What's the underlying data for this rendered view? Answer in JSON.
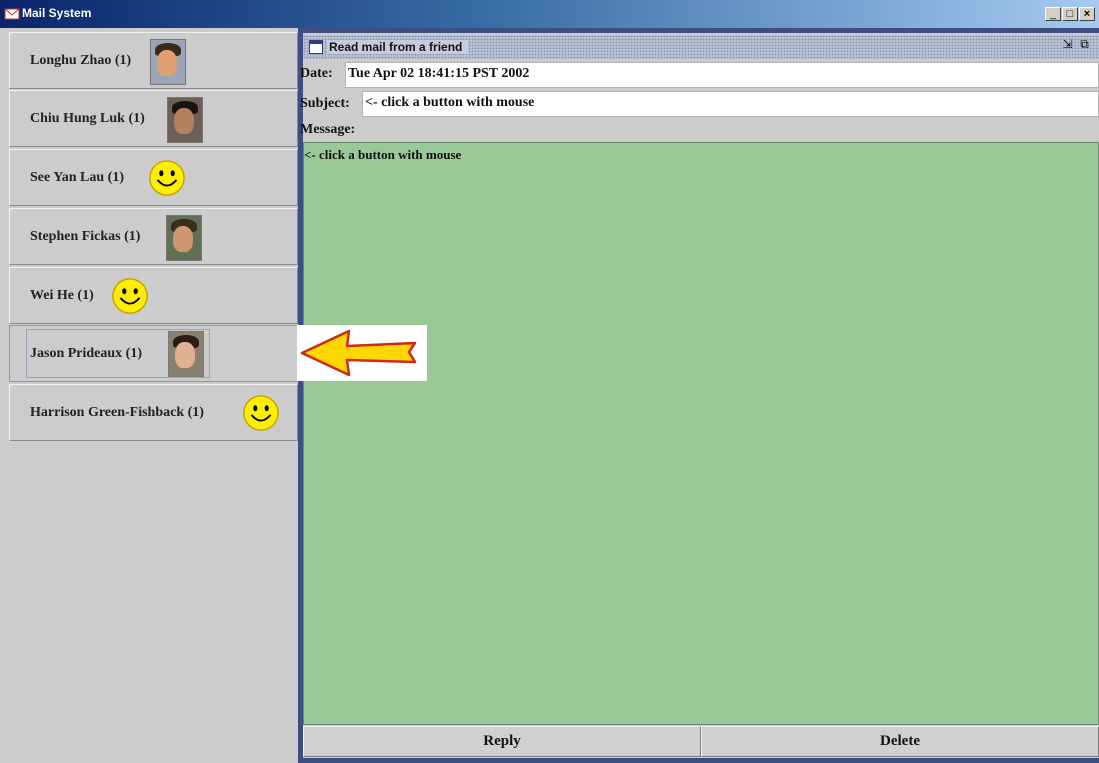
{
  "window": {
    "title": "Mail System",
    "controls": {
      "minimize": "_",
      "maximize": "□",
      "close": "×"
    }
  },
  "friends": [
    {
      "label": "Longhu Zhao (1)",
      "icon": "photo"
    },
    {
      "label": "Chiu Hung Luk (1)",
      "icon": "photo"
    },
    {
      "label": "See Yan Lau (1)",
      "icon": "smiley-icon"
    },
    {
      "label": "Stephen Fickas (1)",
      "icon": "photo"
    },
    {
      "label": "Wei He (1)",
      "icon": "smiley-icon"
    },
    {
      "label": "Jason Prideaux (1)",
      "icon": "photo"
    },
    {
      "label": "Harrison Green-Fishback (1)",
      "icon": "smiley-icon"
    }
  ],
  "mail": {
    "frame_title": "Read mail from a friend",
    "date_label": "Date:",
    "date_value": "Tue Apr 02 18:41:15 PST 2002",
    "subject_label": "Subject:",
    "subject_value": "<- click a button with mouse",
    "message_label": "Message:",
    "message_value": "<- click a button with mouse"
  },
  "actions": {
    "reply": "Reply",
    "delete": "Delete"
  },
  "colors": {
    "message_background": "#99c999",
    "arrow_fill": "#ffd700",
    "arrow_outline": "#cc2a1a"
  }
}
